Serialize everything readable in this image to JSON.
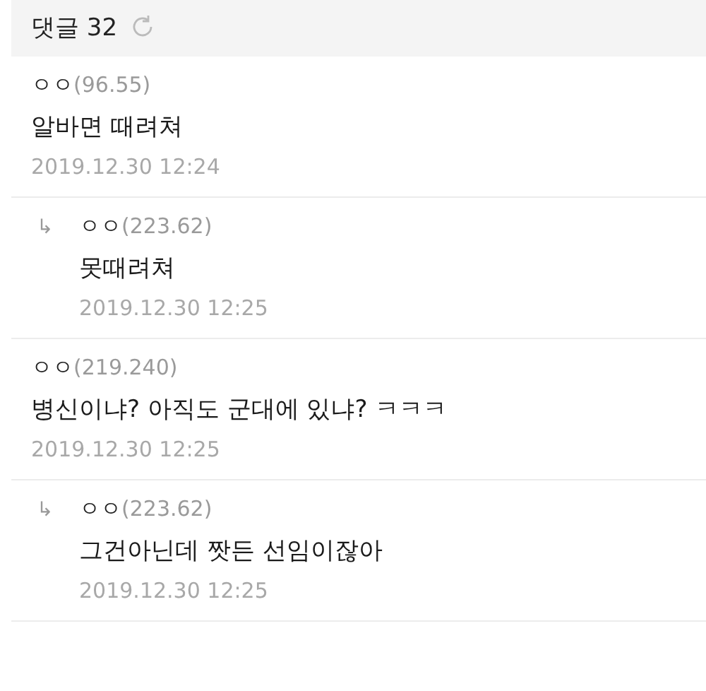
{
  "header": {
    "title": "댓글 32"
  },
  "comments": [
    {
      "kind": "comment",
      "name": "ㅇㅇ",
      "ip": "(96.55)",
      "text": "알바면 때려쳐",
      "date": "2019.12.30 12:24"
    },
    {
      "kind": "reply",
      "arrow": "↳",
      "name": "ㅇㅇ",
      "ip": "(223.62)",
      "text": "못때려쳐",
      "date": "2019.12.30 12:25"
    },
    {
      "kind": "comment",
      "name": "ㅇㅇ",
      "ip": "(219.240)",
      "text": "병신이냐? 아직도 군대에 있냐? ㅋㅋㅋ",
      "date": "2019.12.30 12:25"
    },
    {
      "kind": "reply",
      "arrow": "↳",
      "name": "ㅇㅇ",
      "ip": "(223.62)",
      "text": "그건아닌데 짯든 선임이잖아",
      "date": "2019.12.30 12:25"
    }
  ]
}
